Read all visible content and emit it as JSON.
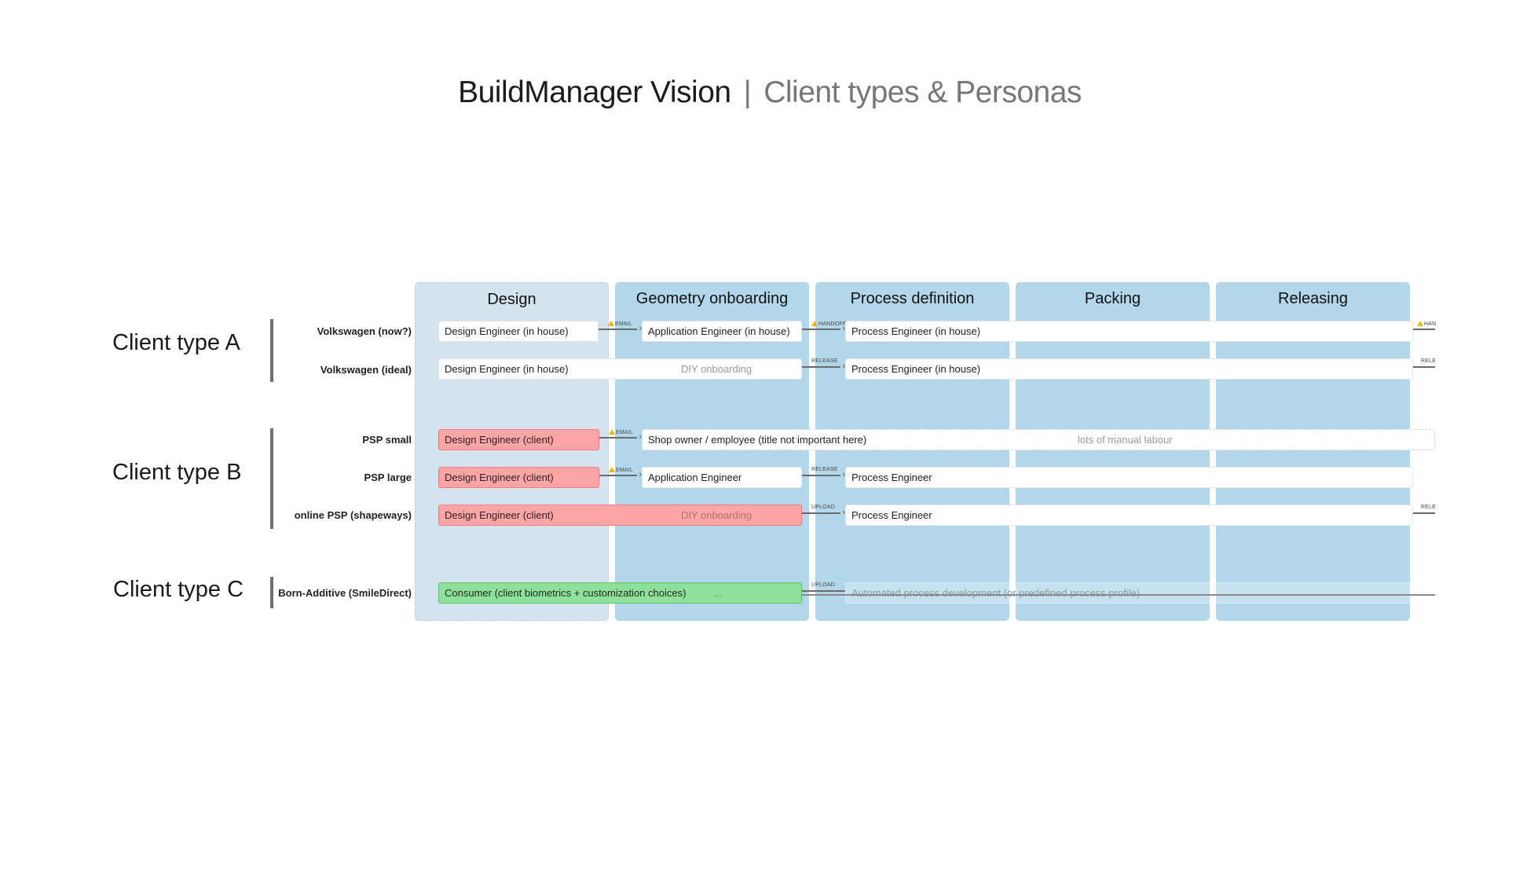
{
  "title": {
    "main": "BuildManager Vision",
    "separator": "|",
    "subtitle": "Client types & Personas"
  },
  "columns": [
    {
      "label": "Design"
    },
    {
      "label": "Geometry onboarding"
    },
    {
      "label": "Process definition"
    },
    {
      "label": "Packing"
    },
    {
      "label": "Releasing"
    }
  ],
  "client_types": [
    {
      "label": "Client type A"
    },
    {
      "label": "Client type B"
    },
    {
      "label": "Client type C"
    }
  ],
  "rows": [
    {
      "label": "Volkswagen (now?)"
    },
    {
      "label": "Volkswagen (ideal)"
    },
    {
      "label": "PSP small"
    },
    {
      "label": "PSP large"
    },
    {
      "label": "online PSP (shapeways)"
    },
    {
      "label": "Born-Additive (SmileDirect)"
    }
  ],
  "personas": {
    "vw_now_design": "Design Engineer (in house)",
    "vw_now_geometry": "Application Engineer (in house)",
    "vw_now_process": "Process Engineer (in house)",
    "vw_ideal_design": "Design Engineer (in house)",
    "vw_ideal_design_note": "DIY onboarding",
    "vw_ideal_process": "Process Engineer (in house)",
    "psp_small_design": "Design Engineer (client)",
    "psp_small_shop": "Shop owner / employee (title not important here)",
    "psp_small_shop_note": "lots of manual labour",
    "psp_large_design": "Design Engineer (client)",
    "psp_large_geometry": "Application Engineer",
    "psp_large_process": "Process Engineer",
    "online_design": "Design Engineer (client)",
    "online_design_note": "DIY onboarding",
    "online_process": "Process Engineer",
    "born_consumer": "Consumer (client biometrics + customization choices)",
    "born_consumer_note": "...",
    "born_automated": "Automated process development (or predefined process profile)"
  },
  "arrows": {
    "email": "EMAIL",
    "handoff": "HANDOFF",
    "release": "RELEASE",
    "upload": "UPLOAD",
    "handoff_cut": "HAN",
    "release_cut": "RELE"
  },
  "colors": {
    "design_column": "#d3e4ee",
    "stage_column": "#b3d7ea",
    "client_persona": "#fca6a8",
    "consumer_persona": "#8ee09a",
    "warning": "#e8b41a"
  }
}
